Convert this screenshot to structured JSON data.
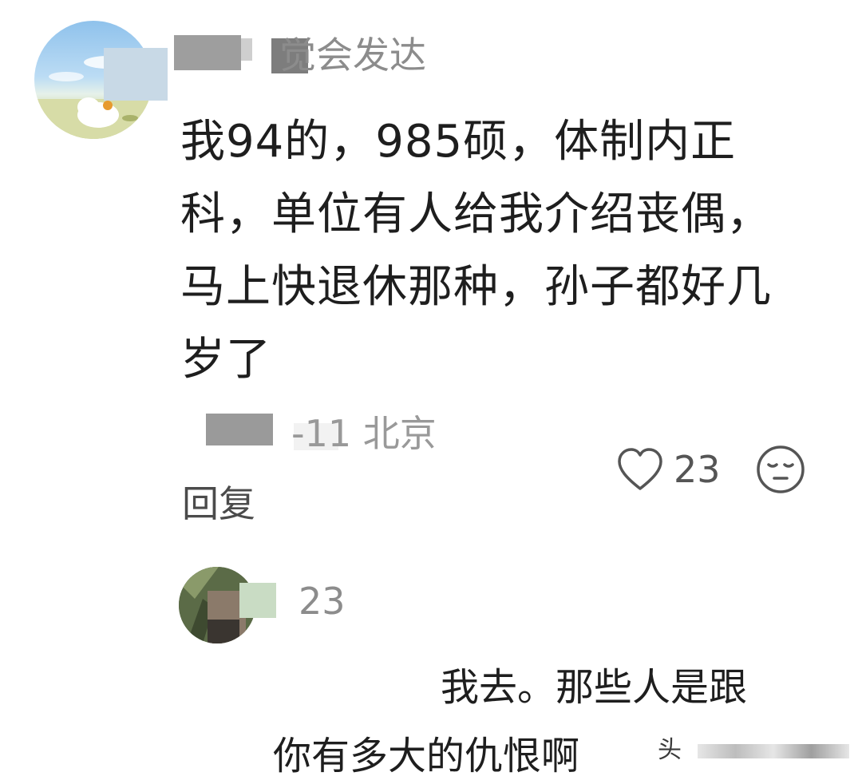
{
  "comment": {
    "username": "觉会发达",
    "text_lines": [
      "我94的，985硕，体制内正",
      "科，单位有人给我介绍丧偶，",
      "马上快退休那种，孙子都好几",
      "岁了"
    ],
    "date_location": "-11 北京",
    "likes": "23",
    "reply_label": "回复",
    "icons": {
      "like": "heart-outline-icon",
      "emoji": "sleepy-face-icon"
    }
  },
  "reply": {
    "username": "23",
    "text_lines": [
      "我去。那些人是跟",
      "你有多大的仇恨啊"
    ]
  },
  "watermark": "头"
}
